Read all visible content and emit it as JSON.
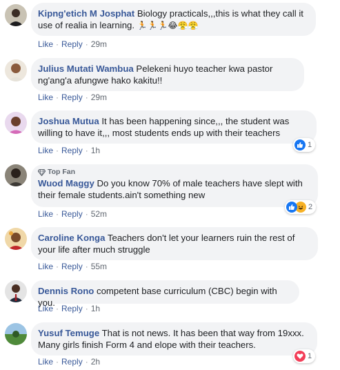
{
  "actions": {
    "like": "Like",
    "reply": "Reply",
    "separator": "·"
  },
  "topfan_label": "Top Fan",
  "comments": [
    {
      "name": "Kipng'etich M Josphat",
      "text": "Biology practicals,,,this is what they call it use of realia in learning.",
      "emojis": "🏃🏃🏃😂😤😤",
      "time": "29m"
    },
    {
      "name": "Julius Mutati Wambua",
      "text": "Pelekeni huyo teacher kwa pastor ng'ang'a afungwe hako kakitu!!",
      "time": "29m"
    },
    {
      "name": "Joshua Mutua",
      "text": "It has been happening since,,, the student was willing to have it,,, most students ends up with their teachers",
      "time": "1h",
      "reaction": {
        "count": "1",
        "type": "like-icon"
      }
    },
    {
      "name": "Wuod Maggy",
      "text": "Do you know 70% of male teachers have slept with their female students.ain't something new",
      "time": "52m",
      "reaction": {
        "count": "2",
        "type": "like-haha-icon"
      }
    },
    {
      "name": "Caroline Konga",
      "text": "Teachers don't let your learners ruin the rest of your life after much struggle",
      "time": "55m"
    },
    {
      "name": "Dennis Rono",
      "text": "competent base curriculum (CBC) begin with you.",
      "time": "1h"
    },
    {
      "name": "Yusuf Temuge",
      "text": "That is not news. It has been that way from 19xxx. Many girls finish Form 4 and elope with their teachers.",
      "time": "2h",
      "reaction": {
        "count": "1",
        "type": "love-icon"
      }
    }
  ],
  "colors": {
    "name": "#385898",
    "bubble": "#f2f3f5",
    "meta": "#606770",
    "like": "#1877f2",
    "love": "#f33e58",
    "haha": "#f7b125"
  }
}
